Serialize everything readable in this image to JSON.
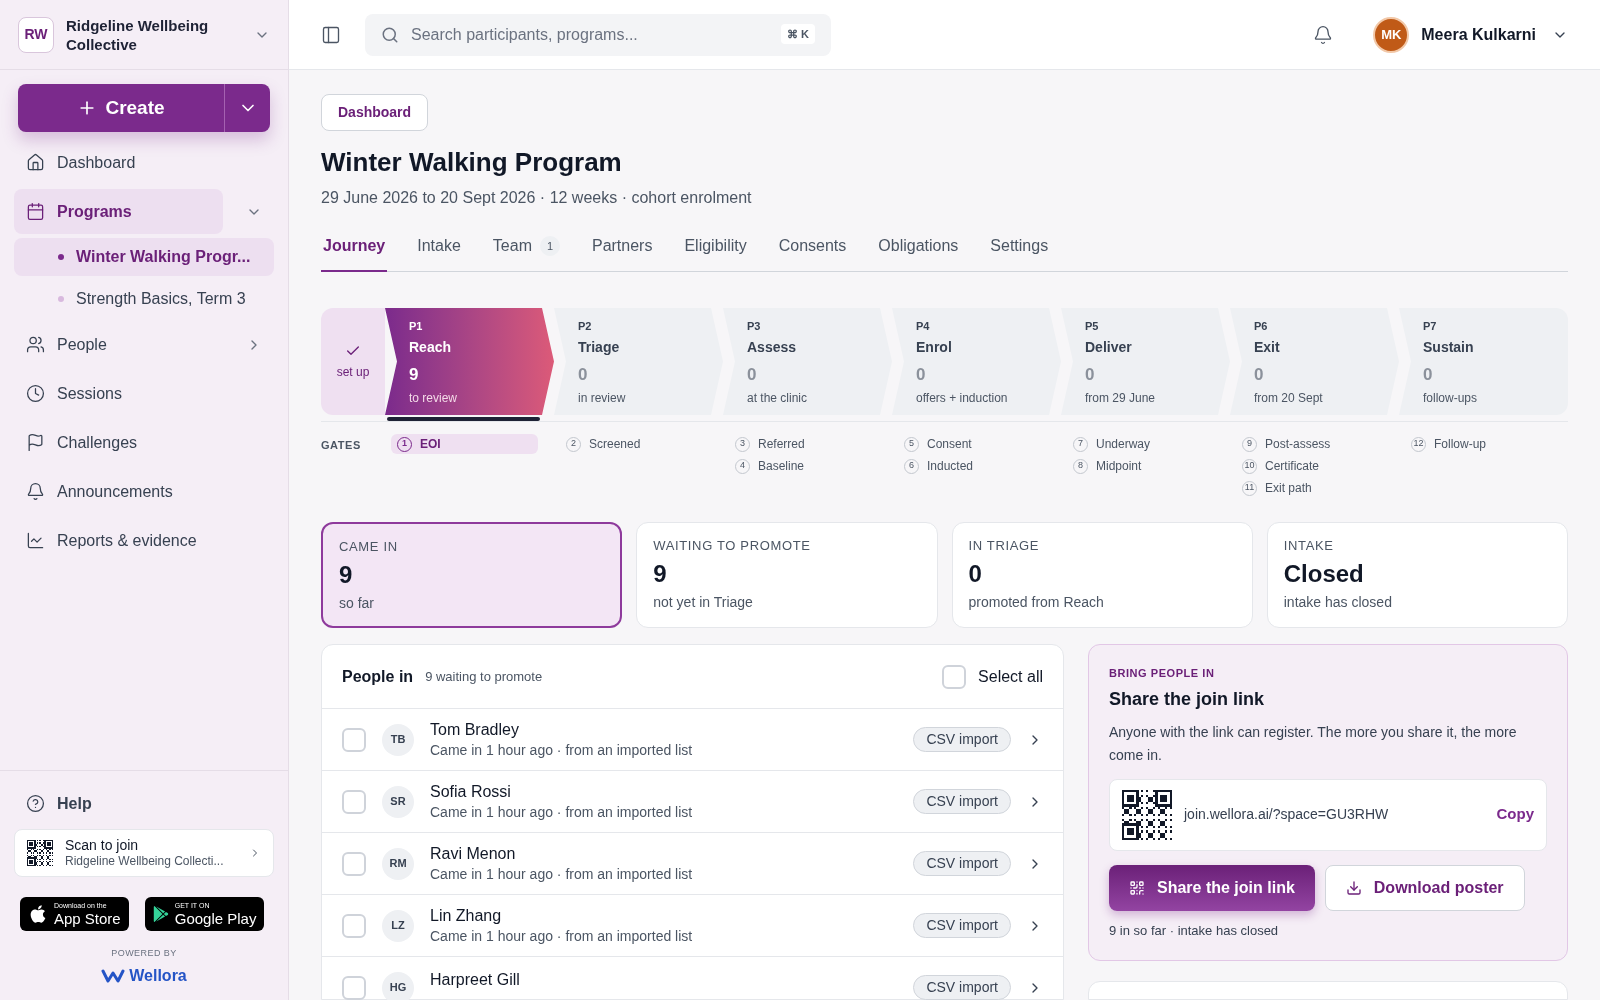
{
  "org": {
    "initials": "RW",
    "name": "Ridgeline Wellbeing Collective"
  },
  "create_button": {
    "label": "Create"
  },
  "nav": [
    {
      "label": "Dashboard",
      "selected": false
    },
    {
      "label": "Programs",
      "selected": true,
      "expanded": true,
      "children": [
        {
          "label": "Winter Walking Progr...",
          "selected": true
        },
        {
          "label": "Strength Basics, Term 3",
          "selected": false
        }
      ]
    },
    {
      "label": "People",
      "selected": false,
      "expanded": false
    },
    {
      "label": "Sessions",
      "selected": false
    },
    {
      "label": "Challenges",
      "selected": false
    },
    {
      "label": "Announcements",
      "selected": false
    },
    {
      "label": "Reports & evidence",
      "selected": false
    }
  ],
  "help": {
    "label": "Help"
  },
  "scan_card": {
    "title": "Scan to join",
    "subtitle": "Ridgeline Wellbeing Collecti..."
  },
  "store_badges": [
    {
      "kind": "apple",
      "small": "Download on the",
      "big": "App Store"
    },
    {
      "kind": "google",
      "small": "GET IT ON",
      "big": "Google Play"
    }
  ],
  "powered_by": {
    "label": "POWERED BY",
    "brand": "Wellora"
  },
  "topbar": {
    "search": {
      "placeholder": "Search participants, programs...",
      "shortcut": "⌘ K"
    },
    "user": {
      "initials": "MK",
      "name": "Meera Kulkarni"
    }
  },
  "breadcrumb": "Dashboard",
  "title": "Winter Walking Program",
  "subtitle": "29 June 2026 to 20 Sept 2026 · 12 weeks · cohort enrolment",
  "tabs": [
    {
      "label": "Journey",
      "selected": true
    },
    {
      "label": "Intake",
      "selected": false
    },
    {
      "label": "Team",
      "count": "1",
      "selected": false
    },
    {
      "label": "Partners",
      "selected": false
    },
    {
      "label": "Eligibility",
      "selected": false
    },
    {
      "label": "Consents",
      "selected": false
    },
    {
      "label": "Obligations",
      "selected": false
    },
    {
      "label": "Settings",
      "selected": false
    }
  ],
  "setup_step": {
    "label": "set up",
    "done": true
  },
  "stages": [
    {
      "code": "P1",
      "name": "Reach",
      "count": "9",
      "caption": "to review",
      "selected": true
    },
    {
      "code": "P2",
      "name": "Triage",
      "count": "0",
      "caption": "in review",
      "selected": false
    },
    {
      "code": "P3",
      "name": "Assess",
      "count": "0",
      "caption": "at the clinic",
      "selected": false
    },
    {
      "code": "P4",
      "name": "Enrol",
      "count": "0",
      "caption": "offers + induction",
      "selected": false
    },
    {
      "code": "P5",
      "name": "Deliver",
      "count": "0",
      "caption": "from 29 June",
      "selected": false
    },
    {
      "code": "P6",
      "name": "Exit",
      "count": "0",
      "caption": "from 20 Sept",
      "selected": false
    },
    {
      "code": "P7",
      "name": "Sustain",
      "count": "0",
      "caption": "follow-ups",
      "selected": false
    }
  ],
  "gates": {
    "label": "GATES",
    "columns": [
      [
        {
          "num": "1",
          "label": "EOI",
          "selected": true
        }
      ],
      [
        {
          "num": "2",
          "label": "Screened",
          "selected": false
        }
      ],
      [
        {
          "num": "3",
          "label": "Referred",
          "selected": false
        },
        {
          "num": "4",
          "label": "Baseline",
          "selected": false
        }
      ],
      [
        {
          "num": "5",
          "label": "Consent",
          "selected": false
        },
        {
          "num": "6",
          "label": "Inducted",
          "selected": false
        }
      ],
      [
        {
          "num": "7",
          "label": "Underway",
          "selected": false
        },
        {
          "num": "8",
          "label": "Midpoint",
          "selected": false
        }
      ],
      [
        {
          "num": "9",
          "label": "Post-assess",
          "selected": false
        },
        {
          "num": "10",
          "label": "Certificate",
          "selected": false
        },
        {
          "num": "11",
          "label": "Exit path",
          "selected": false
        }
      ],
      [
        {
          "num": "12",
          "label": "Follow-up",
          "selected": false
        }
      ]
    ]
  },
  "stats": [
    {
      "label": "CAME IN",
      "value": "9",
      "caption": "so far",
      "selected": true
    },
    {
      "label": "WAITING TO PROMOTE",
      "value": "9",
      "caption": "not yet in Triage",
      "selected": false
    },
    {
      "label": "IN TRIAGE",
      "value": "0",
      "caption": "promoted from Reach",
      "selected": false
    },
    {
      "label": "INTAKE",
      "value": "Closed",
      "caption": "intake has closed",
      "selected": false
    }
  ],
  "people": {
    "title": "People in",
    "subtitle": "9 waiting to promote",
    "select_all": {
      "label": "Select all",
      "checked": false
    },
    "rows": [
      {
        "initials": "TB",
        "name": "Tom Bradley",
        "detail": "Came in 1 hour ago · from an imported list",
        "tag": "CSV import",
        "checked": false
      },
      {
        "initials": "SR",
        "name": "Sofia Rossi",
        "detail": "Came in 1 hour ago · from an imported list",
        "tag": "CSV import",
        "checked": false
      },
      {
        "initials": "RM",
        "name": "Ravi Menon",
        "detail": "Came in 1 hour ago · from an imported list",
        "tag": "CSV import",
        "checked": false
      },
      {
        "initials": "LZ",
        "name": "Lin Zhang",
        "detail": "Came in 1 hour ago · from an imported list",
        "tag": "CSV import",
        "checked": false
      },
      {
        "initials": "HG",
        "name": "Harpreet Gill",
        "tag": "CSV import",
        "checked": false
      }
    ]
  },
  "share": {
    "eyebrow": "BRING PEOPLE IN",
    "title": "Share the join link",
    "body": "Anyone with the link can register. The more you share it, the more come in.",
    "link": "join.wellora.ai/?space=GU3RHW",
    "copy": "Copy",
    "primary": "Share the join link",
    "secondary": "Download poster",
    "footnote": "9 in so far · intake has closed"
  }
}
